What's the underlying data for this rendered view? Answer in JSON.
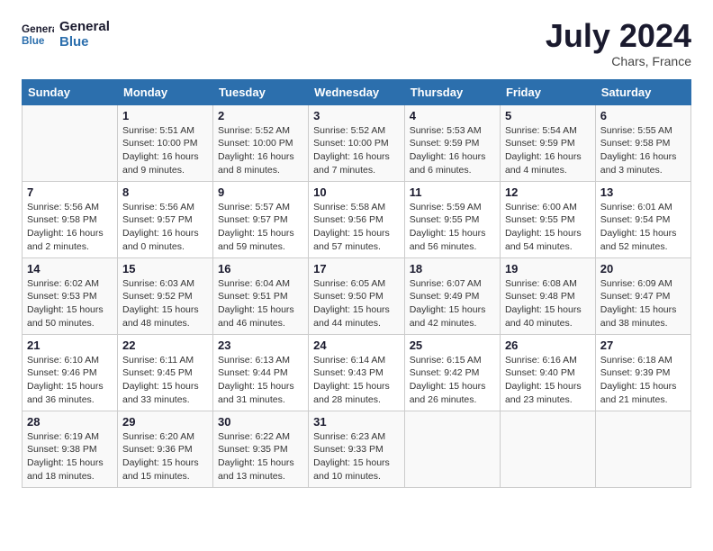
{
  "header": {
    "logo_line1": "General",
    "logo_line2": "Blue",
    "month_title": "July 2024",
    "location": "Chars, France"
  },
  "calendar": {
    "days_of_week": [
      "Sunday",
      "Monday",
      "Tuesday",
      "Wednesday",
      "Thursday",
      "Friday",
      "Saturday"
    ],
    "weeks": [
      [
        {
          "day": "",
          "info": ""
        },
        {
          "day": "1",
          "info": "Sunrise: 5:51 AM\nSunset: 10:00 PM\nDaylight: 16 hours\nand 9 minutes."
        },
        {
          "day": "2",
          "info": "Sunrise: 5:52 AM\nSunset: 10:00 PM\nDaylight: 16 hours\nand 8 minutes."
        },
        {
          "day": "3",
          "info": "Sunrise: 5:52 AM\nSunset: 10:00 PM\nDaylight: 16 hours\nand 7 minutes."
        },
        {
          "day": "4",
          "info": "Sunrise: 5:53 AM\nSunset: 9:59 PM\nDaylight: 16 hours\nand 6 minutes."
        },
        {
          "day": "5",
          "info": "Sunrise: 5:54 AM\nSunset: 9:59 PM\nDaylight: 16 hours\nand 4 minutes."
        },
        {
          "day": "6",
          "info": "Sunrise: 5:55 AM\nSunset: 9:58 PM\nDaylight: 16 hours\nand 3 minutes."
        }
      ],
      [
        {
          "day": "7",
          "info": "Sunrise: 5:56 AM\nSunset: 9:58 PM\nDaylight: 16 hours\nand 2 minutes."
        },
        {
          "day": "8",
          "info": "Sunrise: 5:56 AM\nSunset: 9:57 PM\nDaylight: 16 hours\nand 0 minutes."
        },
        {
          "day": "9",
          "info": "Sunrise: 5:57 AM\nSunset: 9:57 PM\nDaylight: 15 hours\nand 59 minutes."
        },
        {
          "day": "10",
          "info": "Sunrise: 5:58 AM\nSunset: 9:56 PM\nDaylight: 15 hours\nand 57 minutes."
        },
        {
          "day": "11",
          "info": "Sunrise: 5:59 AM\nSunset: 9:55 PM\nDaylight: 15 hours\nand 56 minutes."
        },
        {
          "day": "12",
          "info": "Sunrise: 6:00 AM\nSunset: 9:55 PM\nDaylight: 15 hours\nand 54 minutes."
        },
        {
          "day": "13",
          "info": "Sunrise: 6:01 AM\nSunset: 9:54 PM\nDaylight: 15 hours\nand 52 minutes."
        }
      ],
      [
        {
          "day": "14",
          "info": "Sunrise: 6:02 AM\nSunset: 9:53 PM\nDaylight: 15 hours\nand 50 minutes."
        },
        {
          "day": "15",
          "info": "Sunrise: 6:03 AM\nSunset: 9:52 PM\nDaylight: 15 hours\nand 48 minutes."
        },
        {
          "day": "16",
          "info": "Sunrise: 6:04 AM\nSunset: 9:51 PM\nDaylight: 15 hours\nand 46 minutes."
        },
        {
          "day": "17",
          "info": "Sunrise: 6:05 AM\nSunset: 9:50 PM\nDaylight: 15 hours\nand 44 minutes."
        },
        {
          "day": "18",
          "info": "Sunrise: 6:07 AM\nSunset: 9:49 PM\nDaylight: 15 hours\nand 42 minutes."
        },
        {
          "day": "19",
          "info": "Sunrise: 6:08 AM\nSunset: 9:48 PM\nDaylight: 15 hours\nand 40 minutes."
        },
        {
          "day": "20",
          "info": "Sunrise: 6:09 AM\nSunset: 9:47 PM\nDaylight: 15 hours\nand 38 minutes."
        }
      ],
      [
        {
          "day": "21",
          "info": "Sunrise: 6:10 AM\nSunset: 9:46 PM\nDaylight: 15 hours\nand 36 minutes."
        },
        {
          "day": "22",
          "info": "Sunrise: 6:11 AM\nSunset: 9:45 PM\nDaylight: 15 hours\nand 33 minutes."
        },
        {
          "day": "23",
          "info": "Sunrise: 6:13 AM\nSunset: 9:44 PM\nDaylight: 15 hours\nand 31 minutes."
        },
        {
          "day": "24",
          "info": "Sunrise: 6:14 AM\nSunset: 9:43 PM\nDaylight: 15 hours\nand 28 minutes."
        },
        {
          "day": "25",
          "info": "Sunrise: 6:15 AM\nSunset: 9:42 PM\nDaylight: 15 hours\nand 26 minutes."
        },
        {
          "day": "26",
          "info": "Sunrise: 6:16 AM\nSunset: 9:40 PM\nDaylight: 15 hours\nand 23 minutes."
        },
        {
          "day": "27",
          "info": "Sunrise: 6:18 AM\nSunset: 9:39 PM\nDaylight: 15 hours\nand 21 minutes."
        }
      ],
      [
        {
          "day": "28",
          "info": "Sunrise: 6:19 AM\nSunset: 9:38 PM\nDaylight: 15 hours\nand 18 minutes."
        },
        {
          "day": "29",
          "info": "Sunrise: 6:20 AM\nSunset: 9:36 PM\nDaylight: 15 hours\nand 15 minutes."
        },
        {
          "day": "30",
          "info": "Sunrise: 6:22 AM\nSunset: 9:35 PM\nDaylight: 15 hours\nand 13 minutes."
        },
        {
          "day": "31",
          "info": "Sunrise: 6:23 AM\nSunset: 9:33 PM\nDaylight: 15 hours\nand 10 minutes."
        },
        {
          "day": "",
          "info": ""
        },
        {
          "day": "",
          "info": ""
        },
        {
          "day": "",
          "info": ""
        }
      ]
    ]
  }
}
